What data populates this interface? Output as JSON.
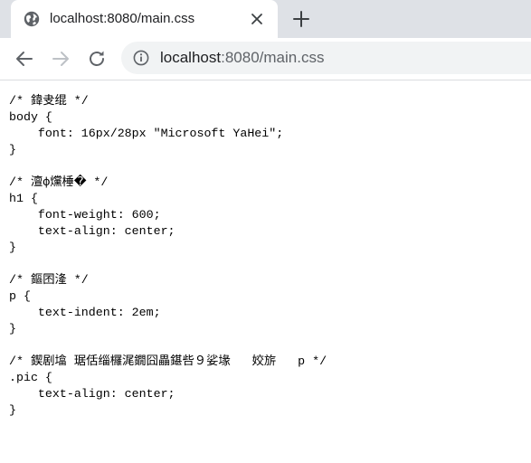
{
  "browser": {
    "tab": {
      "title": "localhost:8080/main.css",
      "favicon": "globe-icon",
      "close_icon": "close-icon"
    },
    "new_tab_icon": "plus-icon",
    "toolbar": {
      "back_icon": "arrow-left-icon",
      "forward_icon": "arrow-right-icon",
      "reload_icon": "reload-icon",
      "info_icon": "info-icon",
      "url_host": "localhost",
      "url_rest": ":8080/main.css"
    },
    "colors": {
      "tabstrip": "#dee1e6",
      "omnibox": "#f1f3f4",
      "icon": "#5f6368",
      "icon_disabled": "#bdc1c6"
    }
  },
  "document": {
    "css_text": "/* 鍏叏绲 */\nbody {\n    font: 16px/28px \"Microsoft YaHei\";\n}\n\n/* 澶ф爣棰� */\nh1 {\n    font-weight: 600;\n    text-align: center;\n}\n\n/* 鏂囨湰 */\np {\n    text-indent: 2em;\n}\n\n/* 鍥剧墖 琚佸缁欏浘鐗囧畾鍖呰９娑堟   姣旂   p */\n.pic {\n    text-align: center;\n}"
  }
}
